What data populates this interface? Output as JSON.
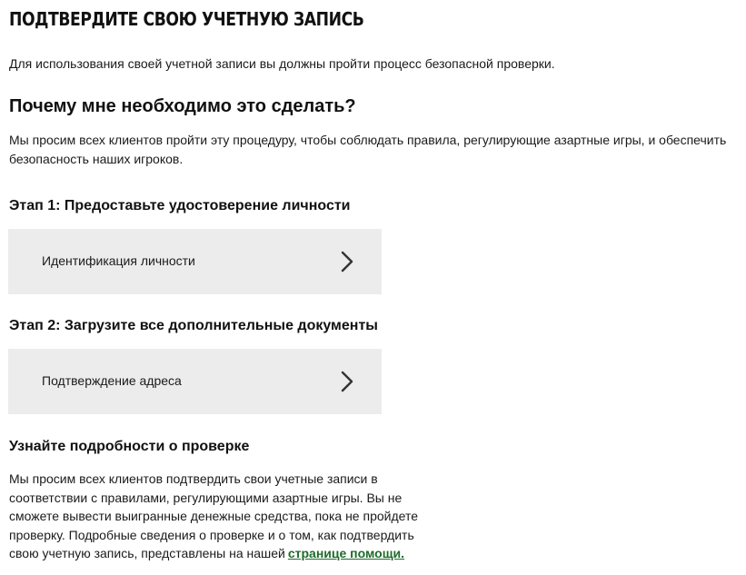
{
  "page": {
    "title": "ПОДТВЕРДИТЕ СВОЮ УЧЕТНУЮ ЗАПИСЬ",
    "intro": "Для использования своей учетной записи вы должны пройти процесс безопасной проверки."
  },
  "why": {
    "heading": "Почему мне необходимо это сделать?",
    "text": "Мы просим всех клиентов пройти эту процедуру, чтобы соблюдать правила, регулирующие азартные игры, и обеспечить безопасность наших игроков."
  },
  "steps": [
    {
      "heading": "Этап 1: Предоставьте удостоверение личности",
      "card_label": "Идентификация личности",
      "icon": "chevron-right-icon"
    },
    {
      "heading": "Этап 2: Загрузите все дополнительные документы",
      "card_label": "Подтверждение адреса",
      "icon": "chevron-right-icon"
    }
  ],
  "more": {
    "heading": "Узнайте подробности о проверке",
    "text": "Мы просим всех клиентов подтвердить свои учетные записи в соответствии с правилами, регулирующими азартные игры. Вы не сможете вывести выигранные денежные средства, пока не пройдете проверку. Подробные сведения о проверке и о том, как подтвердить свою учетную запись, представлены на нашей",
    "link_label": "странице помощи."
  },
  "colors": {
    "card_background": "#ececec",
    "link": "#1e6b2a",
    "text": "#1a1a1a"
  }
}
